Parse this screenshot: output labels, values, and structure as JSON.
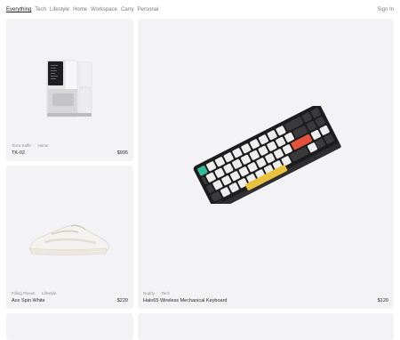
{
  "nav": {
    "links": [
      "Everything",
      "Tech",
      "Lifestyle",
      "Home",
      "Workspace",
      "Carry",
      "Personal"
    ],
    "active": "Everything",
    "sign_in": "Sign In"
  },
  "products": [
    {
      "brand": "Terra Kaffe",
      "category": "Home",
      "name": "TK-02",
      "price": "$995"
    },
    {
      "brand": "Filling Pieces",
      "category": "Lifestyle",
      "name": "Ace Spin White",
      "price": "$220"
    },
    {
      "brand": "Nuphy",
      "category": "Tech",
      "name": "Halo65 Wireless Mechanical Keyboard",
      "price": "$120"
    }
  ]
}
